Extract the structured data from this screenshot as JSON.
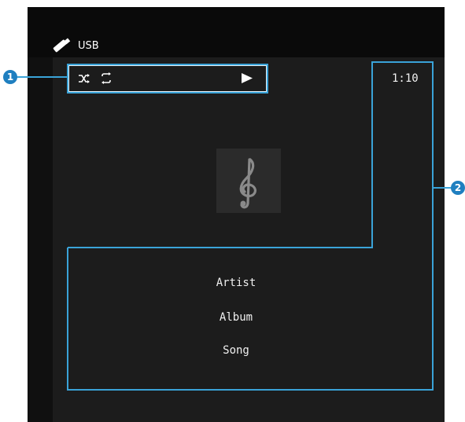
{
  "header": {
    "source_label": "USB",
    "source_icon": "usb-stick-icon"
  },
  "status": {
    "shuffle_icon": "shuffle-icon",
    "repeat_icon": "repeat-icon",
    "play_icon": "play-icon",
    "elapsed_time": "1:10"
  },
  "album_art": {
    "icon": "treble-clef-icon"
  },
  "track_info": {
    "artist": "Artist",
    "album": "Album",
    "song": "Song"
  },
  "callouts": [
    {
      "number": "1"
    },
    {
      "number": "2"
    }
  ],
  "colors": {
    "callout": "#3aa3d8",
    "badge": "#1f7fc0",
    "screen": "#101010"
  }
}
